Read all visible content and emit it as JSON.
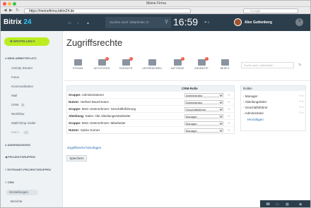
{
  "window": {
    "title": "Meine Firma"
  },
  "browser": {
    "url": "https://meinefirma.bitrix24.de",
    "search_placeholder": "Google"
  },
  "header": {
    "logo_main": "Bitrix",
    "logo_num": "24",
    "search_placeholder": "Suchen nach: Mitarbeiter, D",
    "clock": "16:59",
    "flag_count": "0",
    "user_name": "Alex Guttenberg",
    "help": "?"
  },
  "sidebar": {
    "create_label": "ERSTELLEN",
    "section_work": "MEIN ARBEITSPLATZ",
    "items": [
      "Activity Stream",
      "Fotos",
      "Kommunikation",
      "Mail",
      "CRM",
      "Workflow",
      "MailChimp mailer"
    ],
    "crm_count": "0",
    "more_label": "Mehr...",
    "more_count": "10",
    "sections": [
      "ANWENDUNGEN",
      "PROJEKTGRUPPEN",
      "EXTRANET-PROJEKTGRUPPEN",
      "CRM"
    ],
    "crm_selected": "Einstellungen",
    "crm_last": "Berichte"
  },
  "main": {
    "title": "Zugriffsrechte",
    "toolbar": [
      {
        "label": "STREAM",
        "badge": ""
      },
      {
        "label": "AKTIVITÄTEN",
        "badge": "4"
      },
      {
        "label": "KONTAKTE",
        "badge": "1"
      },
      {
        "label": "UNTERNEHMEN",
        "badge": ""
      },
      {
        "label": "AUFTRÄGE",
        "badge": "5"
      },
      {
        "label": "ANGEBOTE",
        "badge": "7"
      },
      {
        "label": "MEHR ▾",
        "badge": ""
      }
    ],
    "search_placeholder": "Suche nach: Unterstützt...",
    "table": {
      "col_role": "CRM-Rolle",
      "rows": [
        {
          "type": "Gruppe:",
          "name": "Administratoren",
          "role": "Administrator"
        },
        {
          "type": "Nutzer:",
          "name": "Herbert Bauchmann",
          "role": "Administrator"
        },
        {
          "type": "Gruppe:",
          "name": "Mein Unternehmen: Geschäftsführung",
          "role": "Geschäftsführer"
        },
        {
          "type": "Abteilung:",
          "name": "Sales: Alle Abteilungsmitarbeiter",
          "role": "Manager"
        },
        {
          "type": "Gruppe:",
          "name": "Mein Unternehmen: Mitarbeiter",
          "role": "Manager"
        },
        {
          "type": "Nutzer:",
          "name": "Sylvia Gomez",
          "role": "Manager"
        }
      ]
    },
    "add_link": "Zugriffsrecht hinzufügen",
    "save_label": "Speichern",
    "roles": {
      "header": "Rollen",
      "items": [
        "- Manager",
        "- Abteilungsleiter",
        "- Geschäftsführer",
        "- Administrator"
      ],
      "add_link": "Hinzufügen"
    }
  }
}
